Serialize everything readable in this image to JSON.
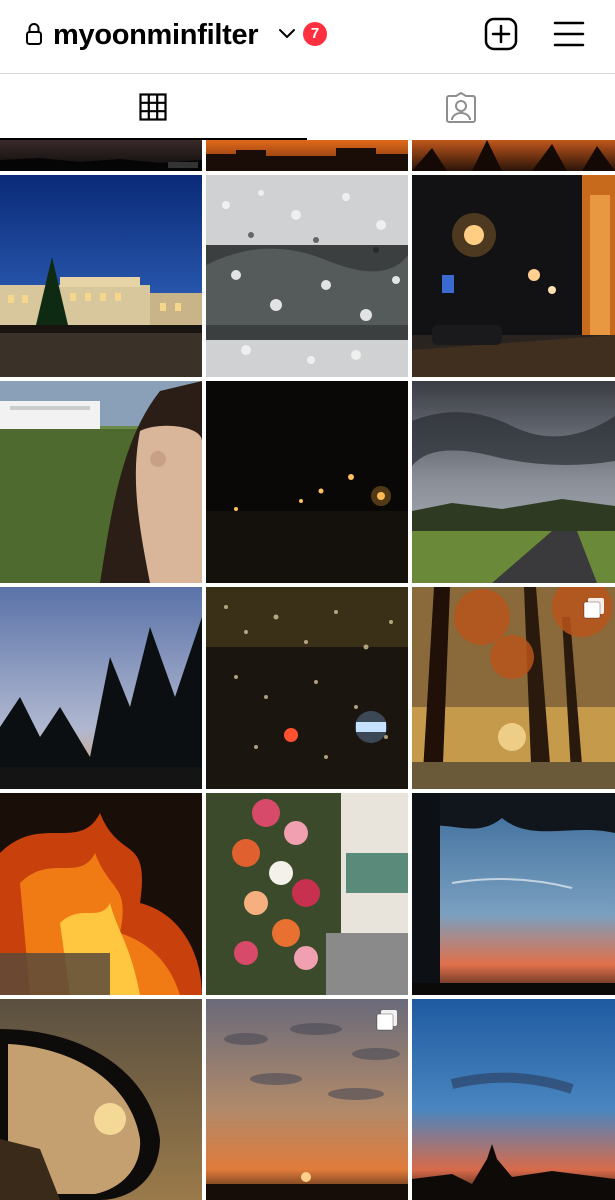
{
  "header": {
    "username": "myoonminfilter",
    "notification_count": "7",
    "icons": [
      "lock-icon",
      "chevron-down-icon",
      "plus-square-icon",
      "hamburger-menu-icon"
    ]
  },
  "tabs": [
    {
      "name": "posts-grid",
      "icon": "grid-icon",
      "selected": true
    },
    {
      "name": "tagged",
      "icon": "tagged-person-icon",
      "selected": false
    }
  ],
  "colors": {
    "badge": "#ff3040",
    "tab_indicator": "#000000",
    "divider": "#dbdbdb"
  },
  "posts": [
    {
      "subject": "sunset silhouette trees (partial)",
      "multiple": false
    },
    {
      "subject": "orange sky over buildings (partial)",
      "multiple": false
    },
    {
      "subject": "sunset through trees (partial)",
      "multiple": false
    },
    {
      "subject": "illuminated building at dusk with christmas tree",
      "multiple": false
    },
    {
      "subject": "rain drops on window",
      "multiple": false
    },
    {
      "subject": "street lights at night",
      "multiple": false
    },
    {
      "subject": "portrait with long hair and white building",
      "multiple": false
    },
    {
      "subject": "dark night bokeh lights",
      "multiple": false
    },
    {
      "subject": "cloudy sky over path",
      "multiple": false
    },
    {
      "subject": "trees silhouette at dusk",
      "multiple": false
    },
    {
      "subject": "rain drops with city lights",
      "multiple": false
    },
    {
      "subject": "autumn trees in park",
      "multiple": true
    },
    {
      "subject": "fire flames",
      "multiple": false
    },
    {
      "subject": "flower decorated cafe",
      "multiple": false
    },
    {
      "subject": "sunset sky with tree",
      "multiple": false
    },
    {
      "subject": "car mirror on forest road",
      "multiple": false
    },
    {
      "subject": "cloudy sunset sky",
      "multiple": true
    },
    {
      "subject": "blue dusk sky with church",
      "multiple": false
    }
  ]
}
